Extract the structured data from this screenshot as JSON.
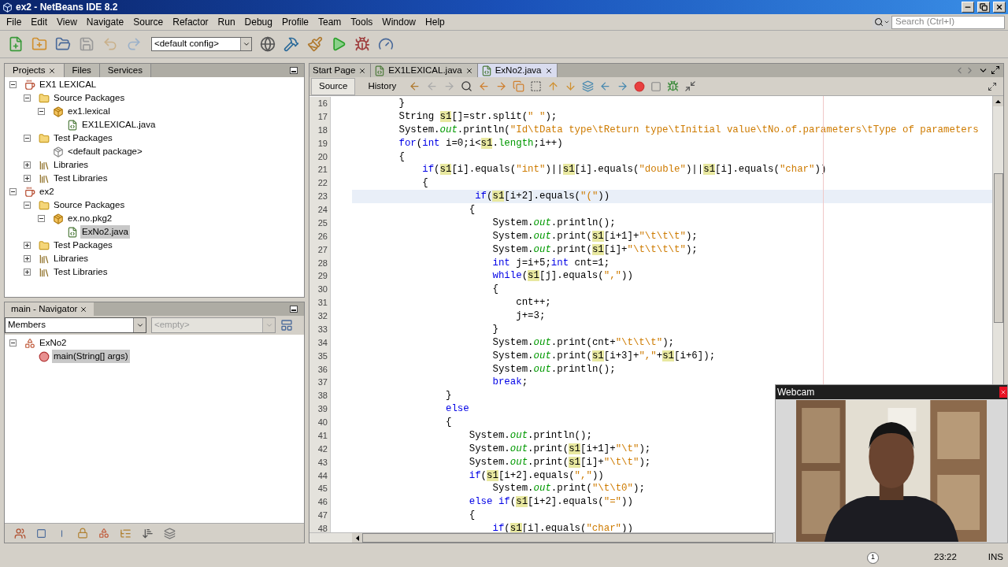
{
  "window": {
    "title": "ex2 - NetBeans IDE 8.2"
  },
  "menu": [
    "File",
    "Edit",
    "View",
    "Navigate",
    "Source",
    "Refactor",
    "Run",
    "Debug",
    "Profile",
    "Team",
    "Tools",
    "Window",
    "Help"
  ],
  "search": {
    "placeholder": "Search (Ctrl+I)"
  },
  "toolbar": {
    "config": "<default config>"
  },
  "projects_panel": {
    "tabs": [
      {
        "label": "Projects",
        "selected": true
      },
      {
        "label": "Files",
        "selected": false
      },
      {
        "label": "Services",
        "selected": false
      }
    ],
    "tree": [
      {
        "label": "EX1 LEXICAL",
        "kind": "project",
        "expanded": true,
        "selected": false,
        "children": [
          {
            "label": "Source Packages",
            "kind": "folder",
            "expanded": true,
            "selected": false,
            "children": [
              {
                "label": "ex1.lexical",
                "kind": "package",
                "expanded": true,
                "selected": false,
                "children": [
                  {
                    "label": "EX1LEXICAL.java",
                    "kind": "java",
                    "selected": false
                  }
                ]
              }
            ]
          },
          {
            "label": "Test Packages",
            "kind": "folder",
            "expanded": true,
            "selected": false,
            "children": [
              {
                "label": "<default package>",
                "kind": "empty-package",
                "selected": false
              }
            ]
          },
          {
            "label": "Libraries",
            "kind": "library",
            "expanded": false,
            "selected": false
          },
          {
            "label": "Test Libraries",
            "kind": "library",
            "expanded": false,
            "selected": false
          }
        ]
      },
      {
        "label": "ex2",
        "kind": "project",
        "expanded": true,
        "selected": false,
        "children": [
          {
            "label": "Source Packages",
            "kind": "folder",
            "expanded": true,
            "selected": false,
            "children": [
              {
                "label": "ex.no.pkg2",
                "kind": "package",
                "expanded": true,
                "selected": false,
                "children": [
                  {
                    "label": "ExNo2.java",
                    "kind": "java",
                    "selected": true
                  }
                ]
              }
            ]
          },
          {
            "label": "Test Packages",
            "kind": "folder",
            "expanded": false,
            "selected": false
          },
          {
            "label": "Libraries",
            "kind": "library",
            "expanded": false,
            "selected": false
          },
          {
            "label": "Test Libraries",
            "kind": "library",
            "expanded": false,
            "selected": false
          }
        ]
      }
    ]
  },
  "navigator": {
    "title": "main - Navigator",
    "filter": "Members",
    "second_filter": {
      "placeholder": "<empty>"
    },
    "tree": [
      {
        "label": "ExNo2",
        "kind": "class",
        "expanded": true,
        "selected": false,
        "children": [
          {
            "label": "main(String[] args)",
            "kind": "method",
            "selected": true
          }
        ]
      }
    ]
  },
  "editor": {
    "tabs": [
      {
        "label": "Start Page",
        "kind": "page",
        "selected": false
      },
      {
        "label": "EX1LEXICAL.java",
        "kind": "java",
        "selected": false
      },
      {
        "label": "ExNo2.java",
        "kind": "java",
        "selected": true
      }
    ],
    "views": [
      {
        "label": "Source",
        "selected": true
      },
      {
        "label": "History",
        "selected": false
      }
    ],
    "lines": [
      {
        "number": "16",
        "current": false,
        "tokens": [
          {
            "text": "        }",
            "kind": "plain"
          }
        ]
      },
      {
        "number": "17",
        "current": false,
        "tokens": [
          {
            "text": "        String ",
            "kind": "plain"
          },
          {
            "text": "s1",
            "kind": "var"
          },
          {
            "text": "[]=str.split(",
            "kind": "plain"
          },
          {
            "text": "\" \"",
            "kind": "string"
          },
          {
            "text": ");",
            "kind": "plain"
          }
        ]
      },
      {
        "number": "18",
        "current": false,
        "tokens": [
          {
            "text": "        System.",
            "kind": "plain"
          },
          {
            "text": "out",
            "kind": "field"
          },
          {
            "text": ".println(",
            "kind": "plain"
          },
          {
            "text": "\"Id\\tData type\\tReturn type\\tInitial value\\tNo.of.parameters\\tType of parameters",
            "kind": "string"
          }
        ]
      },
      {
        "number": "19",
        "current": false,
        "tokens": [
          {
            "text": "        for",
            "kind": "keyword"
          },
          {
            "text": "(",
            "kind": "plain"
          },
          {
            "text": "int",
            "kind": "keyword"
          },
          {
            "text": " i=0;i<",
            "kind": "plain"
          },
          {
            "text": "s1",
            "kind": "var"
          },
          {
            "text": ".",
            "kind": "plain"
          },
          {
            "text": "length",
            "kind": "member"
          },
          {
            "text": ";i++)",
            "kind": "plain"
          }
        ]
      },
      {
        "number": "20",
        "current": false,
        "tokens": [
          {
            "text": "        {",
            "kind": "plain"
          }
        ]
      },
      {
        "number": "21",
        "current": false,
        "tokens": [
          {
            "text": "            if",
            "kind": "keyword"
          },
          {
            "text": "(",
            "kind": "plain"
          },
          {
            "text": "s1",
            "kind": "var"
          },
          {
            "text": "[i].equals(",
            "kind": "plain"
          },
          {
            "text": "\"int\"",
            "kind": "string"
          },
          {
            "text": ")||",
            "kind": "plain"
          },
          {
            "text": "s1",
            "kind": "var"
          },
          {
            "text": "[i].equals(",
            "kind": "plain"
          },
          {
            "text": "\"double\"",
            "kind": "string"
          },
          {
            "text": ")||",
            "kind": "plain"
          },
          {
            "text": "s1",
            "kind": "var"
          },
          {
            "text": "[i].equals(",
            "kind": "plain"
          },
          {
            "text": "\"char\"",
            "kind": "string"
          },
          {
            "text": "))",
            "kind": "plain"
          }
        ]
      },
      {
        "number": "22",
        "current": false,
        "tokens": [
          {
            "text": "            {",
            "kind": "plain"
          }
        ]
      },
      {
        "number": "23",
        "current": true,
        "tokens": [
          {
            "text": "                     if",
            "kind": "keyword"
          },
          {
            "text": "(",
            "kind": "plain"
          },
          {
            "text": "s1",
            "kind": "var"
          },
          {
            "text": "[i+2].equals(",
            "kind": "plain"
          },
          {
            "text": "\"(\"",
            "kind": "string"
          },
          {
            "text": "))",
            "kind": "plain"
          }
        ]
      },
      {
        "number": "24",
        "current": false,
        "tokens": [
          {
            "text": "                    {",
            "kind": "plain"
          }
        ]
      },
      {
        "number": "25",
        "current": false,
        "tokens": [
          {
            "text": "                        System.",
            "kind": "plain"
          },
          {
            "text": "out",
            "kind": "field"
          },
          {
            "text": ".println();",
            "kind": "plain"
          }
        ]
      },
      {
        "number": "26",
        "current": false,
        "tokens": [
          {
            "text": "                        System.",
            "kind": "plain"
          },
          {
            "text": "out",
            "kind": "field"
          },
          {
            "text": ".print(",
            "kind": "plain"
          },
          {
            "text": "s1",
            "kind": "var"
          },
          {
            "text": "[i+1]+",
            "kind": "plain"
          },
          {
            "text": "\"\\t\\t\\t\"",
            "kind": "string"
          },
          {
            "text": ");",
            "kind": "plain"
          }
        ]
      },
      {
        "number": "27",
        "current": false,
        "tokens": [
          {
            "text": "                        System.",
            "kind": "plain"
          },
          {
            "text": "out",
            "kind": "field"
          },
          {
            "text": ".print(",
            "kind": "plain"
          },
          {
            "text": "s1",
            "kind": "var"
          },
          {
            "text": "[i]+",
            "kind": "plain"
          },
          {
            "text": "\"\\t\\t\\t\\t\"",
            "kind": "string"
          },
          {
            "text": ");",
            "kind": "plain"
          }
        ]
      },
      {
        "number": "28",
        "current": false,
        "tokens": [
          {
            "text": "                        int",
            "kind": "keyword"
          },
          {
            "text": " j=i+5;",
            "kind": "plain"
          },
          {
            "text": "int",
            "kind": "keyword"
          },
          {
            "text": " cnt=1;",
            "kind": "plain"
          }
        ]
      },
      {
        "number": "29",
        "current": false,
        "tokens": [
          {
            "text": "                        while",
            "kind": "keyword"
          },
          {
            "text": "(",
            "kind": "plain"
          },
          {
            "text": "s1",
            "kind": "var"
          },
          {
            "text": "[j].equals(",
            "kind": "plain"
          },
          {
            "text": "\",\"",
            "kind": "string"
          },
          {
            "text": "))",
            "kind": "plain"
          }
        ]
      },
      {
        "number": "30",
        "current": false,
        "tokens": [
          {
            "text": "                        {",
            "kind": "plain"
          }
        ]
      },
      {
        "number": "31",
        "current": false,
        "tokens": [
          {
            "text": "                            cnt++;",
            "kind": "plain"
          }
        ]
      },
      {
        "number": "32",
        "current": false,
        "tokens": [
          {
            "text": "                            j+=3;",
            "kind": "plain"
          }
        ]
      },
      {
        "number": "33",
        "current": false,
        "tokens": [
          {
            "text": "                        }",
            "kind": "plain"
          }
        ]
      },
      {
        "number": "34",
        "current": false,
        "tokens": [
          {
            "text": "                        System.",
            "kind": "plain"
          },
          {
            "text": "out",
            "kind": "field"
          },
          {
            "text": ".print(cnt+",
            "kind": "plain"
          },
          {
            "text": "\"\\t\\t\\t\"",
            "kind": "string"
          },
          {
            "text": ");",
            "kind": "plain"
          }
        ]
      },
      {
        "number": "35",
        "current": false,
        "tokens": [
          {
            "text": "                        System.",
            "kind": "plain"
          },
          {
            "text": "out",
            "kind": "field"
          },
          {
            "text": ".print(",
            "kind": "plain"
          },
          {
            "text": "s1",
            "kind": "var"
          },
          {
            "text": "[i+3]+",
            "kind": "plain"
          },
          {
            "text": "\",\"",
            "kind": "string"
          },
          {
            "text": "+",
            "kind": "plain"
          },
          {
            "text": "s1",
            "kind": "var"
          },
          {
            "text": "[i+6]);",
            "kind": "plain"
          }
        ]
      },
      {
        "number": "36",
        "current": false,
        "tokens": [
          {
            "text": "                        System.",
            "kind": "plain"
          },
          {
            "text": "out",
            "kind": "field"
          },
          {
            "text": ".println();",
            "kind": "plain"
          }
        ]
      },
      {
        "number": "37",
        "current": false,
        "tokens": [
          {
            "text": "                        break",
            "kind": "keyword"
          },
          {
            "text": ";",
            "kind": "plain"
          }
        ]
      },
      {
        "number": "38",
        "current": false,
        "tokens": [
          {
            "text": "                }",
            "kind": "plain"
          }
        ]
      },
      {
        "number": "39",
        "current": false,
        "tokens": [
          {
            "text": "                else",
            "kind": "keyword"
          }
        ]
      },
      {
        "number": "40",
        "current": false,
        "tokens": [
          {
            "text": "                {",
            "kind": "plain"
          }
        ]
      },
      {
        "number": "41",
        "current": false,
        "tokens": [
          {
            "text": "                    System.",
            "kind": "plain"
          },
          {
            "text": "out",
            "kind": "field"
          },
          {
            "text": ".println();",
            "kind": "plain"
          }
        ]
      },
      {
        "number": "42",
        "current": false,
        "tokens": [
          {
            "text": "                    System.",
            "kind": "plain"
          },
          {
            "text": "out",
            "kind": "field"
          },
          {
            "text": ".print(",
            "kind": "plain"
          },
          {
            "text": "s1",
            "kind": "var"
          },
          {
            "text": "[i+1]+",
            "kind": "plain"
          },
          {
            "text": "\"\\t\"",
            "kind": "string"
          },
          {
            "text": ");",
            "kind": "plain"
          }
        ]
      },
      {
        "number": "43",
        "current": false,
        "tokens": [
          {
            "text": "                    System.",
            "kind": "plain"
          },
          {
            "text": "out",
            "kind": "field"
          },
          {
            "text": ".print(",
            "kind": "plain"
          },
          {
            "text": "s1",
            "kind": "var"
          },
          {
            "text": "[i]+",
            "kind": "plain"
          },
          {
            "text": "\"\\t\\t\"",
            "kind": "string"
          },
          {
            "text": ");",
            "kind": "plain"
          }
        ]
      },
      {
        "number": "44",
        "current": false,
        "tokens": [
          {
            "text": "                    if",
            "kind": "keyword"
          },
          {
            "text": "(",
            "kind": "plain"
          },
          {
            "text": "s1",
            "kind": "var"
          },
          {
            "text": "[i+2].equals(",
            "kind": "plain"
          },
          {
            "text": "\",\"",
            "kind": "string"
          },
          {
            "text": "))",
            "kind": "plain"
          }
        ]
      },
      {
        "number": "45",
        "current": false,
        "tokens": [
          {
            "text": "                        System.",
            "kind": "plain"
          },
          {
            "text": "out",
            "kind": "field"
          },
          {
            "text": ".print(",
            "kind": "plain"
          },
          {
            "text": "\"\\t\\t0\"",
            "kind": "string"
          },
          {
            "text": ");",
            "kind": "plain"
          }
        ]
      },
      {
        "number": "46",
        "current": false,
        "tokens": [
          {
            "text": "                    else if",
            "kind": "keyword"
          },
          {
            "text": "(",
            "kind": "plain"
          },
          {
            "text": "s1",
            "kind": "var"
          },
          {
            "text": "[i+2].equals(",
            "kind": "plain"
          },
          {
            "text": "\"=\"",
            "kind": "string"
          },
          {
            "text": "))",
            "kind": "plain"
          }
        ]
      },
      {
        "number": "47",
        "current": false,
        "tokens": [
          {
            "text": "                    {",
            "kind": "plain"
          }
        ]
      },
      {
        "number": "48",
        "current": false,
        "tokens": [
          {
            "text": "                        if",
            "kind": "keyword"
          },
          {
            "text": "(",
            "kind": "plain"
          },
          {
            "text": "s1",
            "kind": "var"
          },
          {
            "text": "[i].equals(",
            "kind": "plain"
          },
          {
            "text": "\"char\"",
            "kind": "string"
          },
          {
            "text": "))",
            "kind": "plain"
          }
        ]
      }
    ]
  },
  "webcam": {
    "title": "Webcam",
    "kind": "picture"
  },
  "status_bar": {
    "notifications": "1",
    "time": "23:22",
    "mode": "INS"
  }
}
